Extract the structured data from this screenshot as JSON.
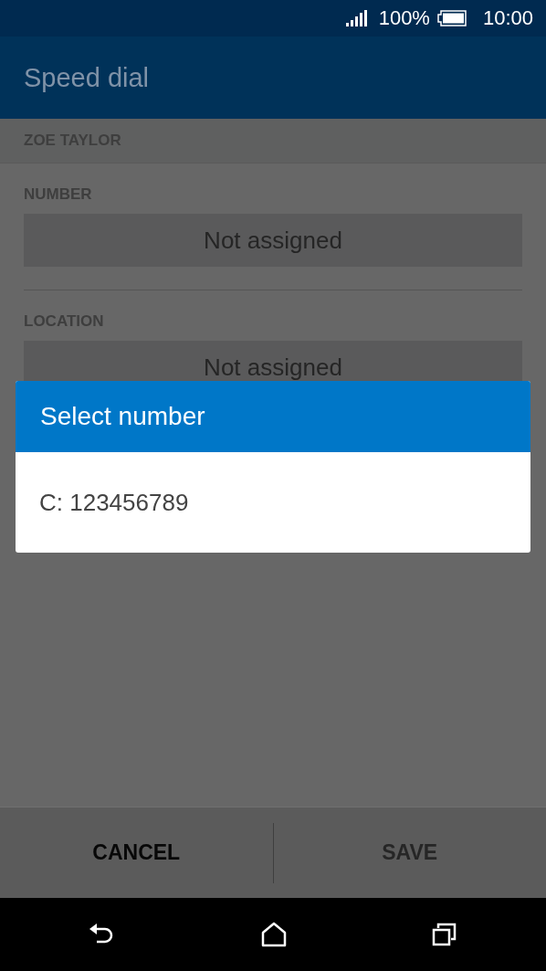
{
  "status_bar": {
    "battery": "100%",
    "time": "10:00"
  },
  "app_bar": {
    "title": "Speed dial"
  },
  "contact": {
    "name": "ZOE TAYLOR"
  },
  "fields": [
    {
      "label": "NUMBER",
      "value": "Not assigned"
    },
    {
      "label": "LOCATION",
      "value": "Not assigned"
    }
  ],
  "dialog": {
    "title": "Select number",
    "options": [
      "C: 123456789"
    ]
  },
  "buttons": [
    {
      "label": "CANCEL",
      "disabled": false
    },
    {
      "label": "SAVE",
      "disabled": true
    }
  ]
}
